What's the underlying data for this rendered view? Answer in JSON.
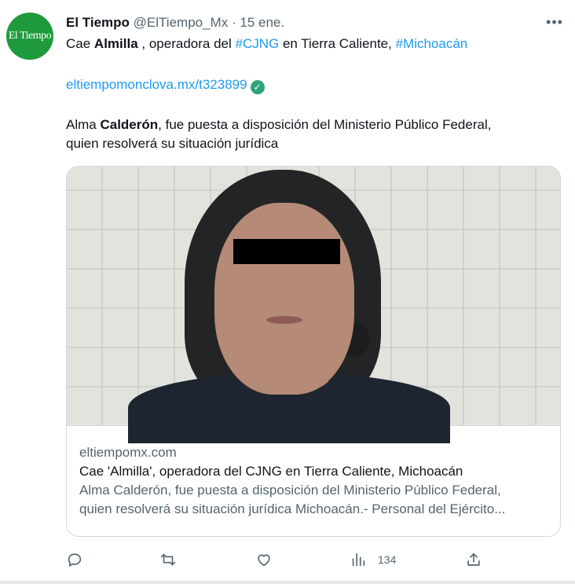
{
  "account": {
    "avatar_text": "El Tiempo",
    "display_name": "El Tiempo",
    "handle": "@ElTiempo_Mx",
    "separator": "·",
    "date": "15 ene."
  },
  "tweet": {
    "line1": {
      "prefix": "Cae ",
      "bold": "Almilla",
      "middle": " , operadora del ",
      "hashtag1": "#CJNG",
      "between": " en Tierra Caliente, ",
      "hashtag2": "#Michoacán"
    },
    "link": "eltiempomonclova.mx/t323899",
    "line2": {
      "prefix": "Alma ",
      "bold": "Calderón",
      "rest": ", fue puesta a disposición del Ministerio Público Federal,"
    },
    "line3": "quien resolverá su situación jurídica"
  },
  "card": {
    "domain": "eltiempomx.com",
    "title": "Cae 'Almilla', operadora del CJNG en Tierra Caliente, Michoacán",
    "desc_line1": "Alma Calderón, fue puesta a disposición del Ministerio Público Federal,",
    "desc_line2": "quien resolverá su situación jurídica Michoacán.- Personal del Ejército..."
  },
  "actions": {
    "views": "134"
  },
  "icons": [
    "more-icon",
    "verified-icon",
    "reply-icon",
    "retweet-icon",
    "like-icon",
    "views-icon",
    "share-icon"
  ],
  "colors": {
    "link": "#1d9bf0",
    "muted": "#536471",
    "avatar": "#1e9a3c",
    "verified": "#2fa377"
  }
}
